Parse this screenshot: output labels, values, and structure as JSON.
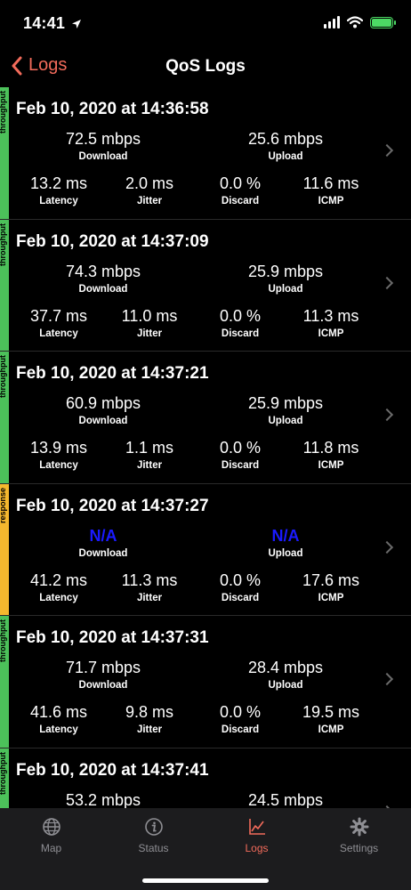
{
  "status": {
    "time": "14:41"
  },
  "nav": {
    "back_label": "Logs",
    "title": "QoS Logs"
  },
  "colors": {
    "accent": "#f26b5b",
    "throughput": "#4cc15a",
    "response": "#f5b82e",
    "na": "#1a1aff"
  },
  "entries": [
    {
      "type": "throughput",
      "title": "Feb 10, 2020 at 14:36:58",
      "download": "72.5 mbps",
      "upload": "25.6 mbps",
      "latency": "13.2 ms",
      "jitter": "2.0 ms",
      "discard": "0.0 %",
      "icmp": "11.6 ms"
    },
    {
      "type": "throughput",
      "title": "Feb 10, 2020 at 14:37:09",
      "download": "74.3 mbps",
      "upload": "25.9 mbps",
      "latency": "37.7 ms",
      "jitter": "11.0 ms",
      "discard": "0.0 %",
      "icmp": "11.3 ms"
    },
    {
      "type": "throughput",
      "title": "Feb 10, 2020 at 14:37:21",
      "download": "60.9 mbps",
      "upload": "25.9 mbps",
      "latency": "13.9 ms",
      "jitter": "1.1 ms",
      "discard": "0.0 %",
      "icmp": "11.8 ms"
    },
    {
      "type": "response",
      "title": "Feb 10, 2020 at 14:37:27",
      "download": "N/A",
      "upload": "N/A",
      "latency": "41.2 ms",
      "jitter": "11.3 ms",
      "discard": "0.0 %",
      "icmp": "17.6 ms"
    },
    {
      "type": "throughput",
      "title": "Feb 10, 2020 at 14:37:31",
      "download": "71.7 mbps",
      "upload": "28.4 mbps",
      "latency": "41.6 ms",
      "jitter": "9.8 ms",
      "discard": "0.0 %",
      "icmp": "19.5 ms"
    },
    {
      "type": "throughput",
      "title": "Feb 10, 2020 at 14:37:41",
      "download": "53.2 mbps",
      "upload": "24.5 mbps",
      "latency": "",
      "jitter": "",
      "discard": "",
      "icmp": ""
    }
  ],
  "labels": {
    "download": "Download",
    "upload": "Upload",
    "latency": "Latency",
    "jitter": "Jitter",
    "discard": "Discard",
    "icmp": "ICMP"
  },
  "tabs": [
    {
      "label": "Map",
      "icon": "globe-icon"
    },
    {
      "label": "Status",
      "icon": "info-icon"
    },
    {
      "label": "Logs",
      "icon": "chart-icon",
      "active": true
    },
    {
      "label": "Settings",
      "icon": "gear-icon"
    }
  ]
}
